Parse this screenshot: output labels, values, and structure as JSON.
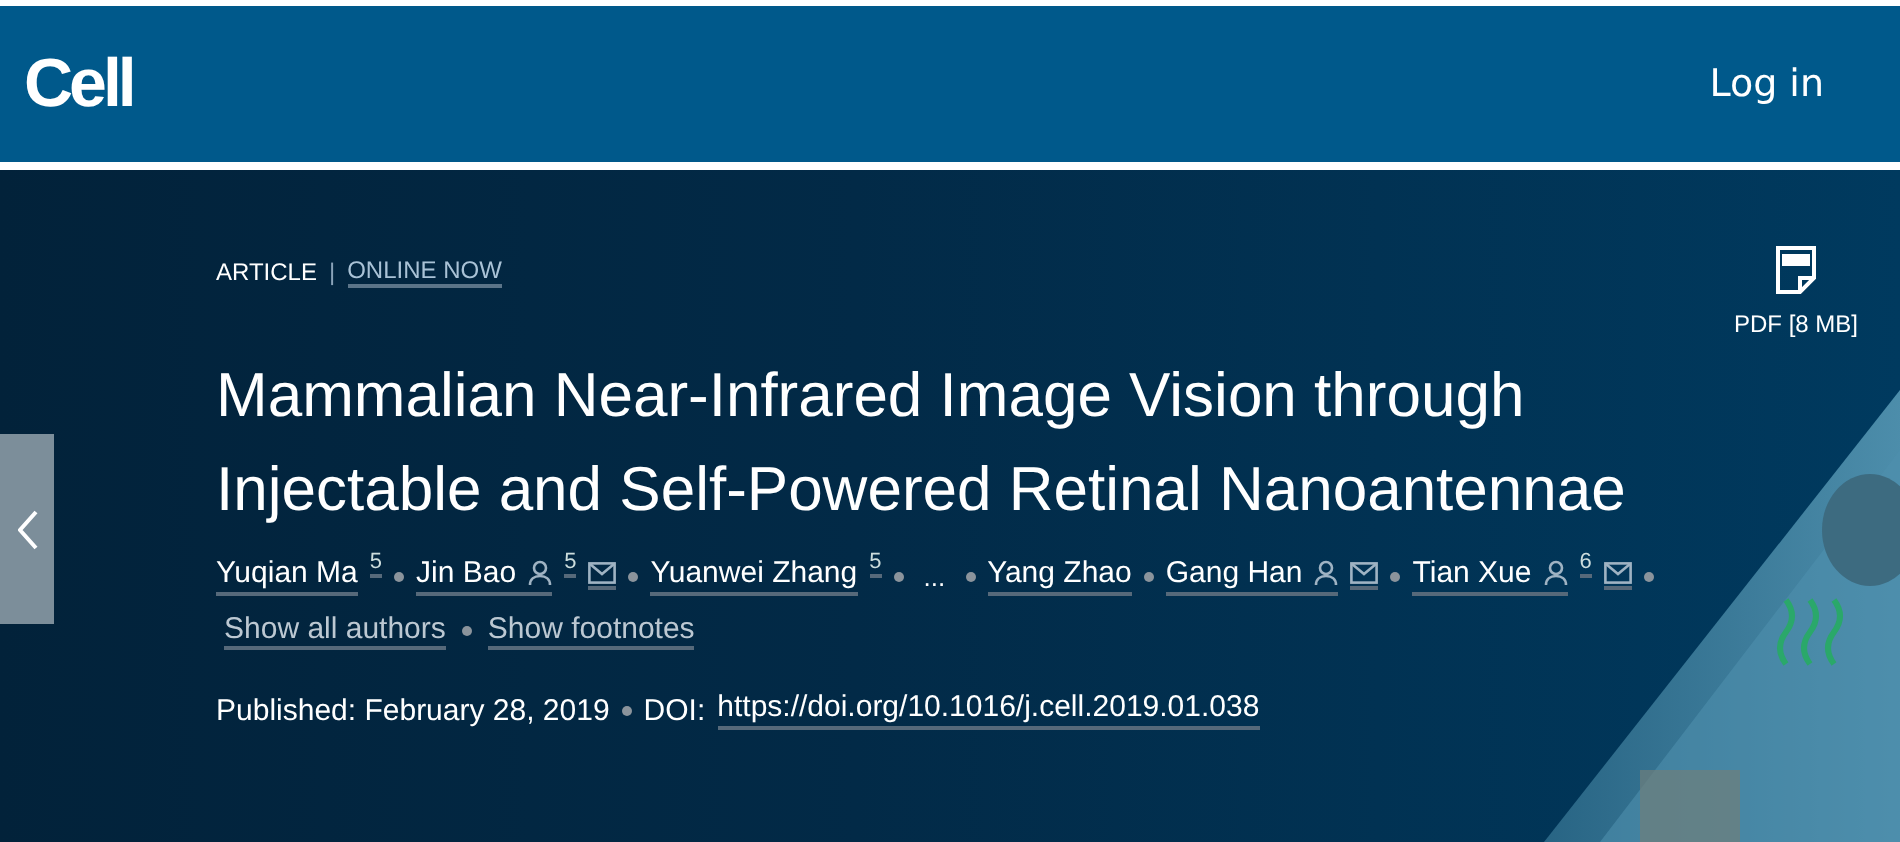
{
  "header": {
    "logo": "Cell",
    "nav": [
      "Log in"
    ]
  },
  "article": {
    "type": "ARTICLE",
    "separator": "|",
    "status": "ONLINE NOW",
    "pdf": "PDF [8 MB]",
    "title": "Mammalian Near-Infrared Image Vision through Injectable and Self-Powered Retinal Nanoantennae",
    "authors": [
      {
        "kind": "author",
        "name": "Yuqian Ma",
        "footnote": "5",
        "profile": false,
        "email": false
      },
      {
        "kind": "author",
        "name": "Jin Bao",
        "footnote": "5",
        "profile": true,
        "email": true
      },
      {
        "kind": "author",
        "name": "Yuanwei Zhang",
        "footnote": "5",
        "profile": false,
        "email": false
      },
      {
        "kind": "ellipsis",
        "text": "..."
      },
      {
        "kind": "author",
        "name": "Yang Zhao",
        "profile": false,
        "email": false
      },
      {
        "kind": "author",
        "name": "Gang Han",
        "profile": true,
        "email": true
      },
      {
        "kind": "author",
        "name": "Tian Xue",
        "footnote": "6",
        "profile": true,
        "email": true
      }
    ],
    "author_links": [
      "Show all authors",
      "Show footnotes"
    ],
    "published": "Published: February 28, 2019",
    "doi_label": "DOI:",
    "doi": "https://doi.org/10.1016/j.cell.2019.01.038"
  }
}
